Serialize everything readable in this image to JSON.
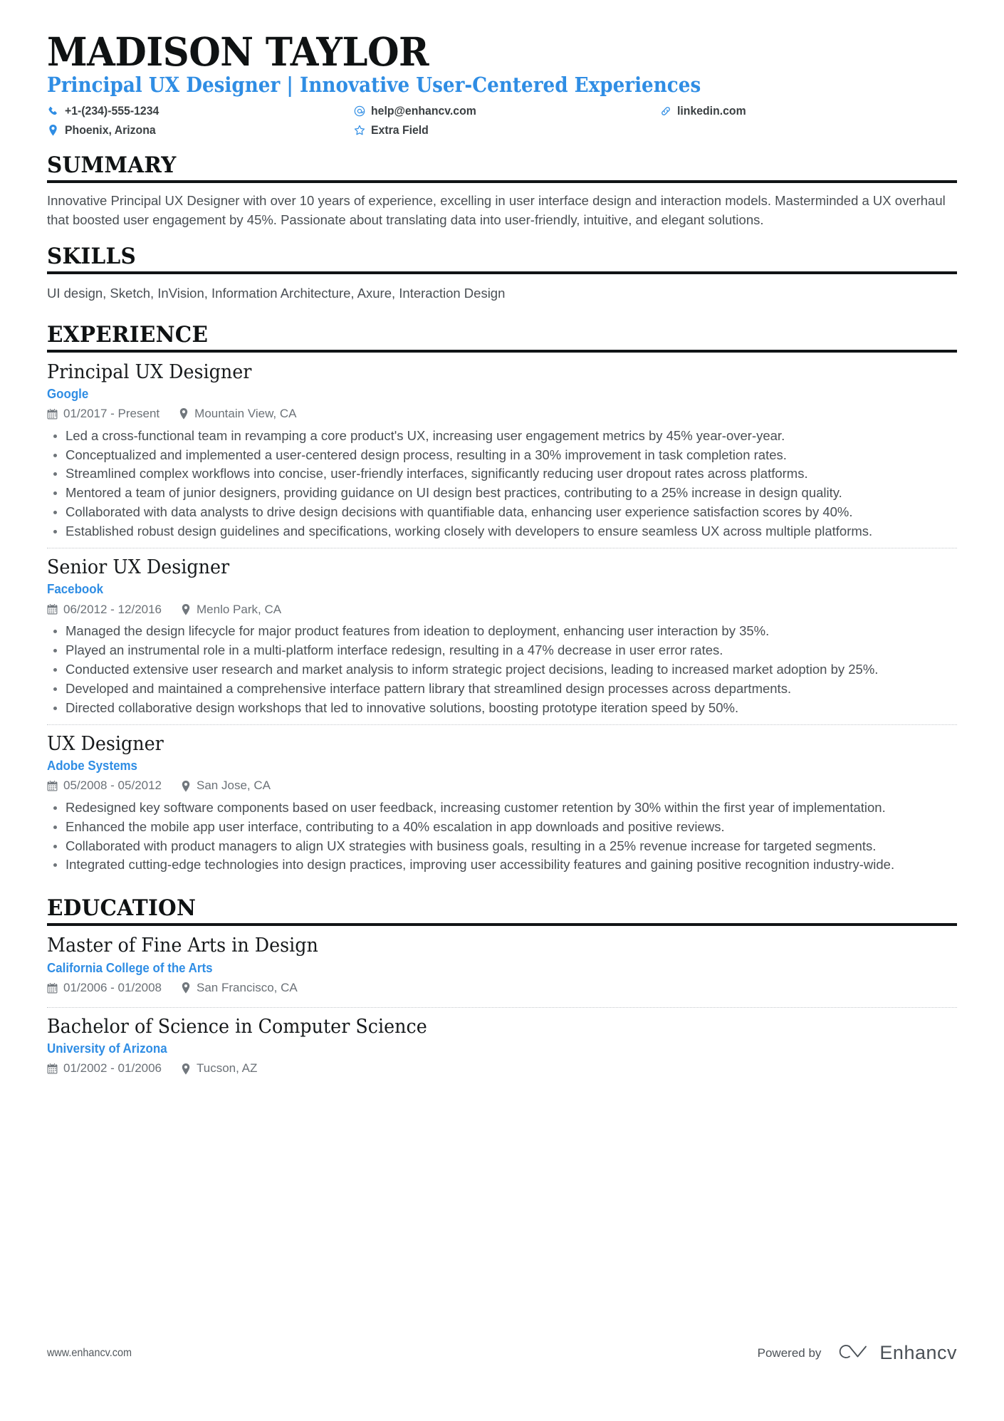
{
  "theme": {
    "accent": "#2f8de4",
    "rule": "#111416",
    "body_text": "#4a4f54",
    "meta_text": "#6b7177"
  },
  "header": {
    "name": "MADISON TAYLOR",
    "headline": "Principal UX Designer | Innovative User-Centered Experiences",
    "contacts": [
      {
        "icon": "phone-icon",
        "text": "+1-(234)-555-1234"
      },
      {
        "icon": "email-icon",
        "text": "help@enhancv.com"
      },
      {
        "icon": "link-icon",
        "text": "linkedin.com"
      },
      {
        "icon": "location-icon",
        "text": "Phoenix, Arizona"
      },
      {
        "icon": "star-icon",
        "text": "Extra Field"
      }
    ]
  },
  "summary": {
    "title": "SUMMARY",
    "text": "Innovative Principal UX Designer with over 10 years of experience, excelling in user interface design and interaction models. Masterminded a UX overhaul that boosted user engagement by 45%. Passionate about translating data into user-friendly, intuitive, and elegant solutions."
  },
  "skills": {
    "title": "SKILLS",
    "text": "UI design, Sketch, InVision, Information Architecture, Axure, Interaction Design"
  },
  "experience": {
    "title": "EXPERIENCE",
    "entries": [
      {
        "title": "Principal UX Designer",
        "org": "Google",
        "dates": "01/2017 - Present",
        "location": "Mountain View, CA",
        "bullets": [
          "Led a cross-functional team in revamping a core product's UX, increasing user engagement metrics by 45% year-over-year.",
          "Conceptualized and implemented a user-centered design process, resulting in a 30% improvement in task completion rates.",
          "Streamlined complex workflows into concise, user-friendly interfaces, significantly reducing user dropout rates across platforms.",
          "Mentored a team of junior designers, providing guidance on UI design best practices, contributing to a 25% increase in design quality.",
          "Collaborated with data analysts to drive design decisions with quantifiable data, enhancing user experience satisfaction scores by 40%.",
          "Established robust design guidelines and specifications, working closely with developers to ensure seamless UX across multiple platforms."
        ]
      },
      {
        "title": "Senior UX Designer",
        "org": "Facebook",
        "dates": "06/2012 - 12/2016",
        "location": "Menlo Park, CA",
        "bullets": [
          "Managed the design lifecycle for major product features from ideation to deployment, enhancing user interaction by 35%.",
          "Played an instrumental role in a multi-platform interface redesign, resulting in a 47% decrease in user error rates.",
          "Conducted extensive user research and market analysis to inform strategic project decisions, leading to increased market adoption by 25%.",
          "Developed and maintained a comprehensive interface pattern library that streamlined design processes across departments.",
          "Directed collaborative design workshops that led to innovative solutions, boosting prototype iteration speed by 50%."
        ]
      },
      {
        "title": "UX Designer",
        "org": "Adobe Systems",
        "dates": "05/2008 - 05/2012",
        "location": "San Jose, CA",
        "bullets": [
          "Redesigned key software components based on user feedback, increasing customer retention by 30% within the first year of implementation.",
          "Enhanced the mobile app user interface, contributing to a 40% escalation in app downloads and positive reviews.",
          "Collaborated with product managers to align UX strategies with business goals, resulting in a 25% revenue increase for targeted segments.",
          "Integrated cutting-edge technologies into design practices, improving user accessibility features and gaining positive recognition industry-wide."
        ]
      }
    ]
  },
  "education": {
    "title": "EDUCATION",
    "entries": [
      {
        "title": "Master of Fine Arts in Design",
        "org": "California College of the Arts",
        "dates": "01/2006 - 01/2008",
        "location": "San Francisco, CA"
      },
      {
        "title": "Bachelor of Science in Computer Science",
        "org": "University of Arizona",
        "dates": "01/2002 - 01/2006",
        "location": "Tucson, AZ"
      }
    ]
  },
  "footer": {
    "url": "www.enhancv.com",
    "powered_by": "Powered by",
    "brand": "Enhancv"
  }
}
